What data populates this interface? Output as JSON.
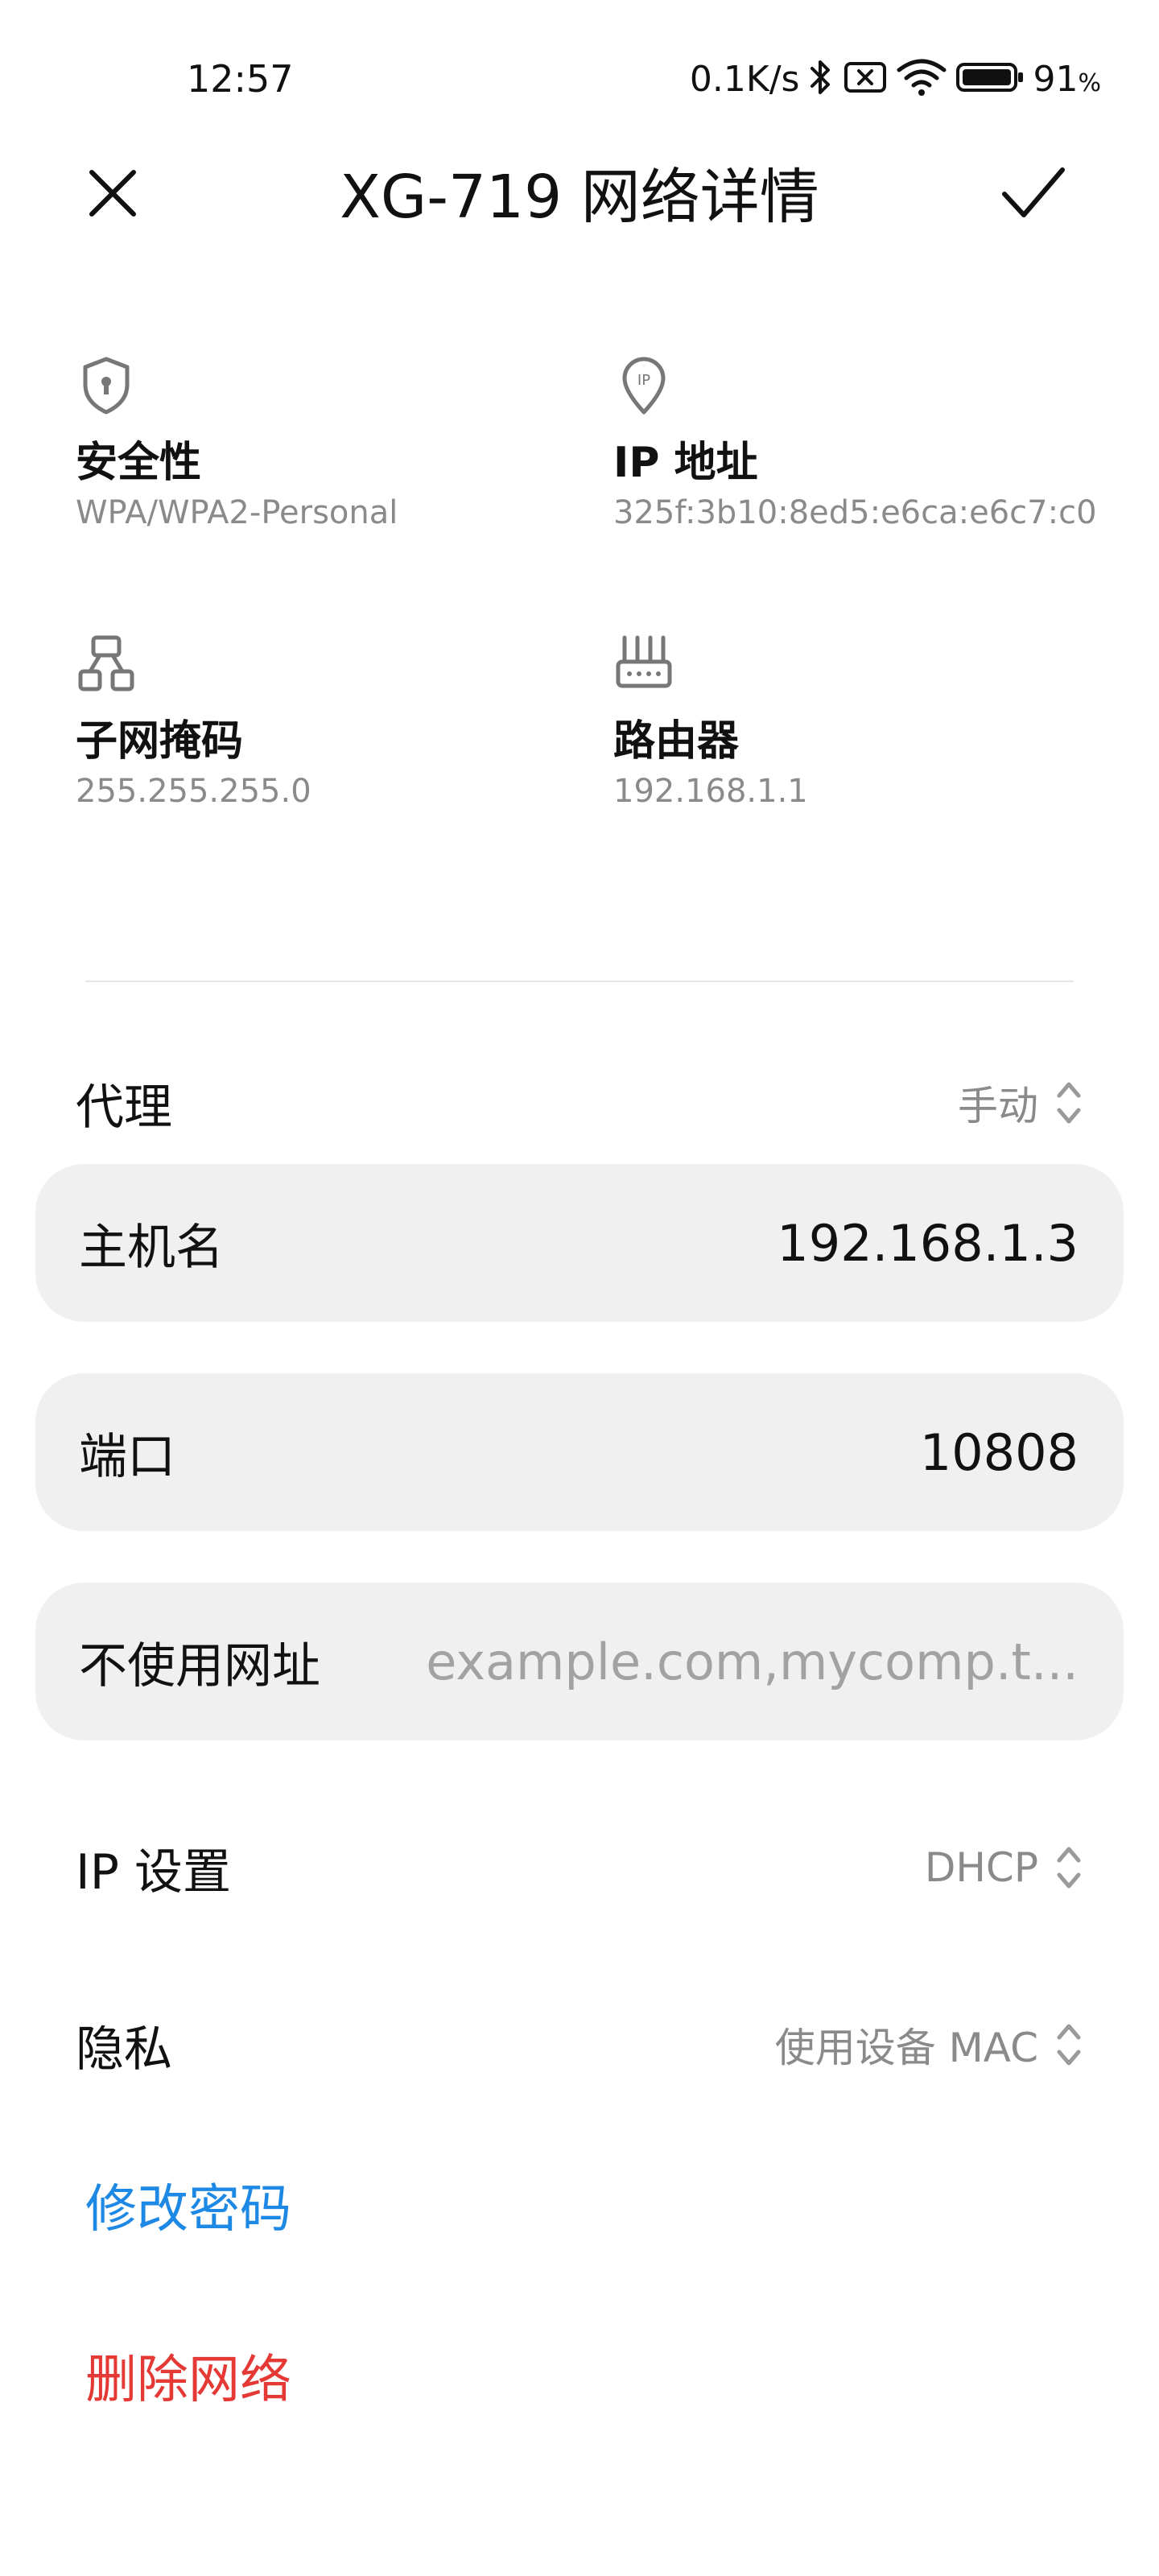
{
  "status_bar": {
    "time": "12:57",
    "net_speed": "0.1K/s",
    "battery_percent": "91",
    "battery_unit": "%"
  },
  "header": {
    "title": "XG-719 网络详情",
    "close_icon": "close-icon",
    "confirm_icon": "check-icon"
  },
  "info": {
    "security": {
      "label": "安全性",
      "value": "WPA/WPA2-Personal",
      "icon": "shield-icon"
    },
    "ip": {
      "label": "IP 地址",
      "value": "325f:3b10:8ed5:e6ca:e6c7:c0",
      "icon": "location-pin-ip-icon"
    },
    "subnet": {
      "label": "子网掩码",
      "value": "255.255.255.0",
      "icon": "network-hierarchy-icon"
    },
    "router": {
      "label": "路由器",
      "value": "192.168.1.1",
      "icon": "router-icon"
    }
  },
  "proxy": {
    "label": "代理",
    "value": "手动"
  },
  "hostname": {
    "label": "主机名",
    "value": "192.168.1.3"
  },
  "port": {
    "label": "端口",
    "value": "10808"
  },
  "bypass": {
    "label": "不使用网址",
    "placeholder": "example.com,mycomp.t..."
  },
  "ip_settings": {
    "label": "IP 设置",
    "value": "DHCP"
  },
  "privacy": {
    "label": "隐私",
    "value": "使用设备 MAC"
  },
  "actions": {
    "change_password": "修改密码",
    "delete_network": "删除网络"
  },
  "colors": {
    "accent_blue": "#1e88e5",
    "danger_red": "#e53935",
    "field_bg": "#f0f0f0",
    "secondary_text": "#8a8a8a"
  }
}
